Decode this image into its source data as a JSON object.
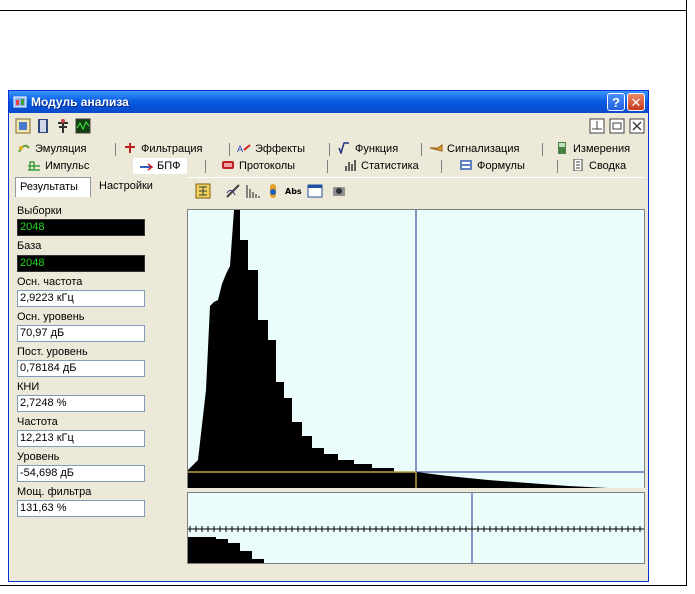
{
  "window": {
    "title": "Модуль анализа",
    "help_label": "?",
    "close_label": "✕"
  },
  "toolbar": {
    "icons": [
      "app-settings-icon",
      "book-icon",
      "antenna-icon",
      "oscilloscope-icon"
    ],
    "right_icons": [
      "tile-icon",
      "minimize-icon",
      "close-icon"
    ]
  },
  "tabs_row1": [
    {
      "label": "Эмуляция",
      "icon": "emulation-icon"
    },
    {
      "label": "Фильтрация",
      "icon": "filter-icon"
    },
    {
      "label": "Эффекты",
      "icon": "effects-icon"
    },
    {
      "label": "Функция",
      "icon": "function-icon"
    },
    {
      "label": "Сигнализация",
      "icon": "alarm-icon"
    },
    {
      "label": "Измерения",
      "icon": "measure-icon"
    }
  ],
  "tabs_row2": [
    {
      "label": "Импульс",
      "icon": "pulse-icon"
    },
    {
      "label": "БПФ",
      "icon": "fft-icon",
      "active": true
    },
    {
      "label": "Протоколы",
      "icon": "protocols-icon"
    },
    {
      "label": "Статистика",
      "icon": "stats-icon"
    },
    {
      "label": "Формулы",
      "icon": "formulas-icon"
    },
    {
      "label": "Сводка",
      "icon": "summary-icon"
    }
  ],
  "subtabs": {
    "results": "Результаты",
    "settings": "Настройки"
  },
  "fields": {
    "samples_label": "Выборки",
    "samples_value": "2048",
    "base_label": "База",
    "base_value": "2048",
    "main_freq_label": "Осн. частота",
    "main_freq_value": "2,9223 кГц",
    "main_level_label": "Осн. уровень",
    "main_level_value": "70,97 дБ",
    "dc_level_label": "Пост. уровень",
    "dc_level_value": "0,78184 дБ",
    "thd_label": "КНИ",
    "thd_value": "2,7248 %",
    "freq_label": "Частота",
    "freq_value": "12,213 кГц",
    "level_label": "Уровень",
    "level_value": "-54,698 дБ",
    "filter_power_label": "Мощ. фильтра",
    "filter_power_value": "131,63 %"
  },
  "plot_toolbar": {
    "icons": [
      "grid-icon",
      "pen-icon",
      "bars-icon",
      "hand-icon",
      "abs-icon",
      "window-icon",
      "camera-icon"
    ],
    "abs_label": "Abs"
  },
  "colors": {
    "plot_bg": "#eafcfc",
    "spectrum": "#000000",
    "cursor": "#1c2f8c",
    "marker_line": "#b8a040",
    "value_text": "#21d521"
  }
}
